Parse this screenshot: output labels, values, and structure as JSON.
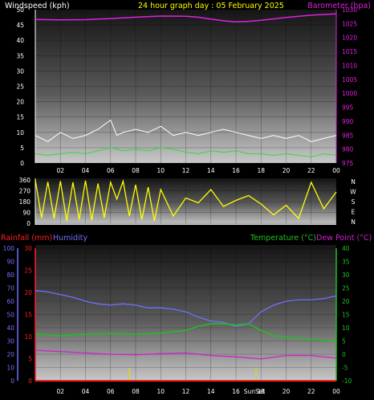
{
  "colors": {
    "bg": "#000000",
    "wind_label": "#ffffff",
    "baro": "#e020e0",
    "wind_avg": "#33dd33",
    "wind_gust": "#ffffff",
    "dir": "#ffff00",
    "rain": "#ff2020",
    "humidity": "#7070ff",
    "temp": "#20c020",
    "dew": "#d020d0",
    "tick": "#ffffff",
    "sun": "#dddd00"
  },
  "x_ticks": [
    "02",
    "04",
    "06",
    "08",
    "10",
    "12",
    "14",
    "16",
    "18",
    "20",
    "22",
    "00"
  ],
  "chart_data": [
    {
      "type": "line",
      "title": "24 hour graph day : 05 February 2025",
      "left_label": "Windspeed (kph)",
      "right_label": "Barometer (hpa)",
      "wind_ticks": [
        "0",
        "5",
        "10",
        "15",
        "20",
        "25",
        "30",
        "35",
        "40",
        "45",
        "50"
      ],
      "baro_ticks": [
        "975",
        "980",
        "985",
        "990",
        "995",
        "1000",
        "1005",
        "1010",
        "1015",
        "1020",
        "1025",
        "1030"
      ],
      "wind_ylim": [
        0,
        50
      ],
      "baro_ylim": [
        975,
        1030
      ],
      "baro_x": [
        0,
        2,
        4,
        6,
        8,
        10,
        12,
        13,
        14,
        15,
        16,
        17,
        18,
        20,
        22,
        24
      ],
      "baro_values": [
        1026.5,
        1026.3,
        1026.4,
        1026.8,
        1027.3,
        1027.7,
        1027.6,
        1027.3,
        1026.6,
        1026,
        1025.6,
        1025.8,
        1026.2,
        1027.2,
        1028,
        1028.5
      ],
      "series": [
        {
          "name": "gust",
          "x": [
            0,
            1,
            2,
            3,
            4,
            5,
            6,
            6.5,
            7,
            8,
            9,
            10,
            11,
            12,
            13,
            14,
            15,
            16,
            17,
            18,
            19,
            20,
            21,
            22,
            23,
            24
          ],
          "values": [
            9,
            7,
            10,
            8,
            9,
            11,
            14,
            9,
            10,
            11,
            10,
            12,
            9,
            10,
            9,
            10,
            11,
            10,
            9,
            8,
            9,
            8,
            9,
            7,
            8,
            9
          ]
        },
        {
          "name": "avg",
          "x": [
            0,
            1,
            2,
            3,
            4,
            5,
            6,
            7,
            8,
            9,
            10,
            11,
            12,
            13,
            14,
            15,
            16,
            17,
            18,
            19,
            20,
            21,
            22,
            23,
            24
          ],
          "values": [
            3,
            2.5,
            3,
            3.5,
            3,
            4,
            5,
            4,
            4.5,
            4,
            5,
            4.5,
            3.5,
            3,
            4,
            3.5,
            4,
            3,
            3,
            2.5,
            3,
            2.5,
            2,
            3,
            2.5
          ]
        }
      ]
    },
    {
      "type": "line",
      "dir_ticks": [
        "360",
        "270",
        "180",
        "90",
        "0"
      ],
      "compass": [
        "N",
        "W",
        "S",
        "E",
        "N"
      ],
      "ylim": [
        0,
        360
      ],
      "x": [
        0,
        0.5,
        1,
        1.5,
        2,
        2.5,
        3,
        3.5,
        4,
        4.5,
        5,
        5.5,
        6,
        6.5,
        7,
        7.5,
        8,
        8.5,
        9,
        9.5,
        10,
        11,
        12,
        13,
        14,
        15,
        16,
        17,
        18,
        19,
        20,
        21,
        22,
        23,
        24
      ],
      "values": [
        360,
        45,
        345,
        40,
        350,
        20,
        340,
        30,
        355,
        25,
        330,
        45,
        340,
        200,
        350,
        60,
        320,
        30,
        300,
        20,
        280,
        60,
        210,
        170,
        280,
        140,
        190,
        230,
        160,
        70,
        150,
        40,
        340,
        120,
        260
      ]
    },
    {
      "type": "line",
      "rain_label": "Rainfall (mm)",
      "humidity_label": "Humidity",
      "temp_label": "Temperature (°C)",
      "dew_label": "Dew Point (°C)",
      "hum_ticks": [
        "0",
        "10",
        "20",
        "30",
        "40",
        "50",
        "60",
        "70",
        "80",
        "90",
        "100"
      ],
      "rain_ticks": [
        "0",
        "5",
        "10",
        "15",
        "20",
        "25",
        "30"
      ],
      "temp_ticks": [
        "-10",
        "-5",
        "0",
        "5",
        "10",
        "15",
        "20",
        "25",
        "30",
        "35",
        "40"
      ],
      "hum_ylim": [
        0,
        100
      ],
      "rain_ylim": [
        0,
        30
      ],
      "temp_ylim": [
        -10,
        40
      ],
      "sun_labels": [
        "Sun",
        "Set"
      ],
      "series": [
        {
          "name": "Humidity",
          "x": [
            0,
            1,
            2,
            3,
            4,
            5,
            6,
            7,
            8,
            9,
            10,
            11,
            12,
            13,
            14,
            15,
            16,
            17,
            18,
            19,
            20,
            21,
            22,
            23,
            24
          ],
          "values": [
            68,
            67,
            65,
            63,
            60,
            58,
            57,
            58,
            57,
            55,
            55,
            54,
            52,
            48,
            45,
            44,
            41,
            43,
            52,
            57,
            60,
            61,
            61,
            62,
            64
          ]
        },
        {
          "name": "Temperature (°C)",
          "x": [
            0,
            2,
            4,
            6,
            8,
            10,
            12,
            13,
            14,
            15,
            16,
            17,
            18,
            19,
            20,
            22,
            24
          ],
          "values": [
            7.5,
            7,
            7.5,
            7.8,
            7.5,
            8,
            9,
            10.5,
            11.5,
            11.5,
            11,
            11.5,
            9,
            7,
            6.5,
            5.5,
            5
          ]
        },
        {
          "name": "Dew Point (°C)",
          "x": [
            0,
            2,
            4,
            6,
            8,
            10,
            12,
            14,
            16,
            18,
            20,
            22,
            24
          ],
          "values": [
            1.5,
            1,
            0.5,
            0,
            -0.2,
            0.2,
            0.5,
            -0.5,
            -1,
            -1.8,
            -0.5,
            -0.5,
            -1.5
          ]
        },
        {
          "name": "Rainfall (mm)",
          "x": [
            0,
            24
          ],
          "values": [
            0,
            0
          ]
        }
      ]
    }
  ]
}
